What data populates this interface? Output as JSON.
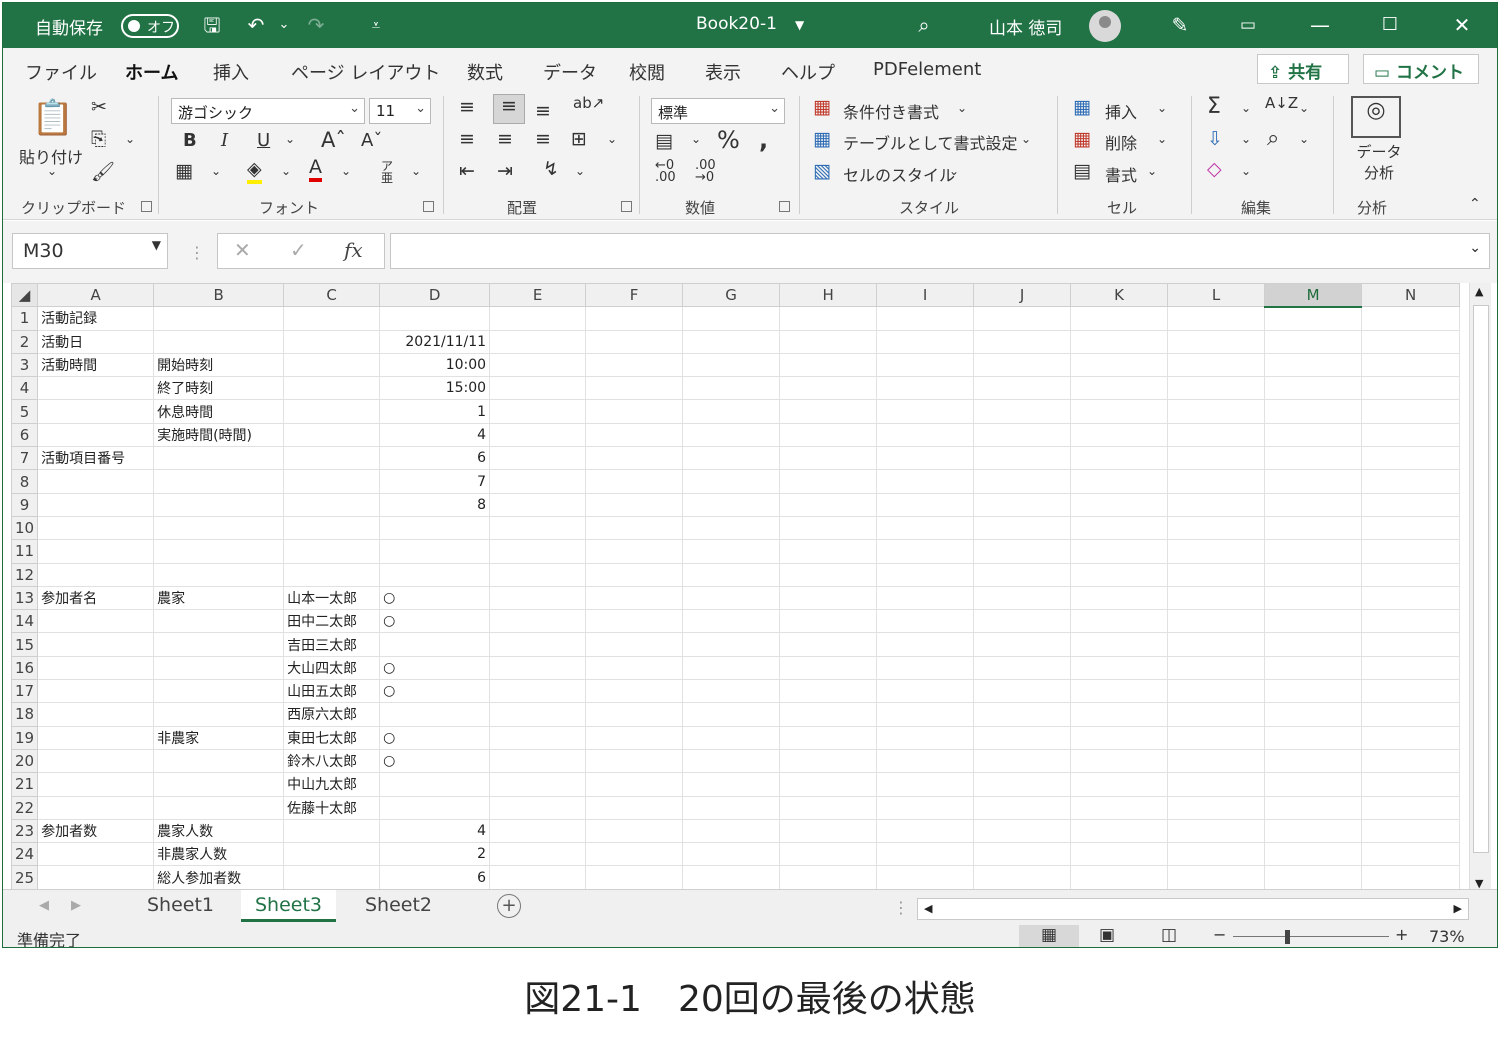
{
  "titlebar": {
    "autosave_label": "自動保存",
    "autosave_state": "オフ",
    "doc_title": "Book20-1",
    "user_name": "山本 徳司"
  },
  "menu_tabs": [
    "ファイル",
    "ホーム",
    "挿入",
    "ページ レイアウト",
    "数式",
    "データ",
    "校閲",
    "表示",
    "ヘルプ",
    "PDFelement"
  ],
  "active_tab": "ホーム",
  "share_button": "共有",
  "comment_button": "コメント",
  "ribbon": {
    "clipboard": {
      "paste": "貼り付け",
      "label": "クリップボード"
    },
    "font": {
      "name": "游ゴシック",
      "size": "11",
      "label": "フォント",
      "bold": "B",
      "italic": "I",
      "underline": "U"
    },
    "alignment": {
      "label": "配置"
    },
    "number": {
      "format": "標準",
      "label": "数値"
    },
    "styles": {
      "conditional": "条件付き書式",
      "as_table": "テーブルとして書式設定",
      "cell_styles": "セルのスタイル",
      "label": "スタイル"
    },
    "cells": {
      "insert": "挿入",
      "delete": "削除",
      "format": "書式",
      "label": "セル"
    },
    "editing": {
      "label": "編集"
    },
    "analysis": {
      "button": "データ分析",
      "label": "分析"
    }
  },
  "formula_bar": {
    "name_box": "M30",
    "cancel": "✕",
    "enter": "✓",
    "fx": "fx",
    "formula": ""
  },
  "columns": [
    "A",
    "B",
    "C",
    "D",
    "E",
    "F",
    "G",
    "H",
    "I",
    "J",
    "K",
    "L",
    "M",
    "N"
  ],
  "selected_column": "M",
  "rows": [
    {
      "n": "1",
      "A": "活動記録",
      "B": "",
      "C": "",
      "D": ""
    },
    {
      "n": "2",
      "A": "活動日",
      "B": "",
      "C": "",
      "D": "2021/11/11"
    },
    {
      "n": "3",
      "A": "活動時間",
      "B": "開始時刻",
      "C": "",
      "D": "10:00"
    },
    {
      "n": "4",
      "A": "",
      "B": "終了時刻",
      "C": "",
      "D": "15:00"
    },
    {
      "n": "5",
      "A": "",
      "B": "休息時間",
      "C": "",
      "D": "1"
    },
    {
      "n": "6",
      "A": "",
      "B": "実施時間(時間)",
      "C": "",
      "D": "4"
    },
    {
      "n": "7",
      "A": "活動項目番号",
      "B": "",
      "C": "",
      "D": "6"
    },
    {
      "n": "8",
      "A": "",
      "B": "",
      "C": "",
      "D": "7"
    },
    {
      "n": "9",
      "A": "",
      "B": "",
      "C": "",
      "D": "8"
    },
    {
      "n": "10",
      "A": "",
      "B": "",
      "C": "",
      "D": ""
    },
    {
      "n": "11",
      "A": "",
      "B": "",
      "C": "",
      "D": ""
    },
    {
      "n": "12",
      "A": "",
      "B": "",
      "C": "",
      "D": ""
    },
    {
      "n": "13",
      "A": "参加者名",
      "B": "農家",
      "C": "山本一太郎",
      "D": "○"
    },
    {
      "n": "14",
      "A": "",
      "B": "",
      "C": "田中二太郎",
      "D": "○"
    },
    {
      "n": "15",
      "A": "",
      "B": "",
      "C": "吉田三太郎",
      "D": ""
    },
    {
      "n": "16",
      "A": "",
      "B": "",
      "C": "大山四太郎",
      "D": "○"
    },
    {
      "n": "17",
      "A": "",
      "B": "",
      "C": "山田五太郎",
      "D": "○"
    },
    {
      "n": "18",
      "A": "",
      "B": "",
      "C": "西原六太郎",
      "D": ""
    },
    {
      "n": "19",
      "A": "",
      "B": "非農家",
      "C": "東田七太郎",
      "D": "○"
    },
    {
      "n": "20",
      "A": "",
      "B": "",
      "C": "鈴木八太郎",
      "D": "○"
    },
    {
      "n": "21",
      "A": "",
      "B": "",
      "C": "中山九太郎",
      "D": ""
    },
    {
      "n": "22",
      "A": "",
      "B": "",
      "C": "佐藤十太郎",
      "D": ""
    },
    {
      "n": "23",
      "A": "参加者数",
      "B": "農家人数",
      "C": "",
      "D": "4"
    },
    {
      "n": "24",
      "A": "",
      "B": "非農家人数",
      "C": "",
      "D": "2"
    },
    {
      "n": "25",
      "A": "",
      "B": "総人参加者数",
      "C": "",
      "D": "6"
    }
  ],
  "sheets": [
    "Sheet1",
    "Sheet3",
    "Sheet2"
  ],
  "active_sheet": "Sheet3",
  "status": {
    "ready": "準備完了",
    "zoom": "73%"
  },
  "caption": "図21-1　20回の最後の状態"
}
